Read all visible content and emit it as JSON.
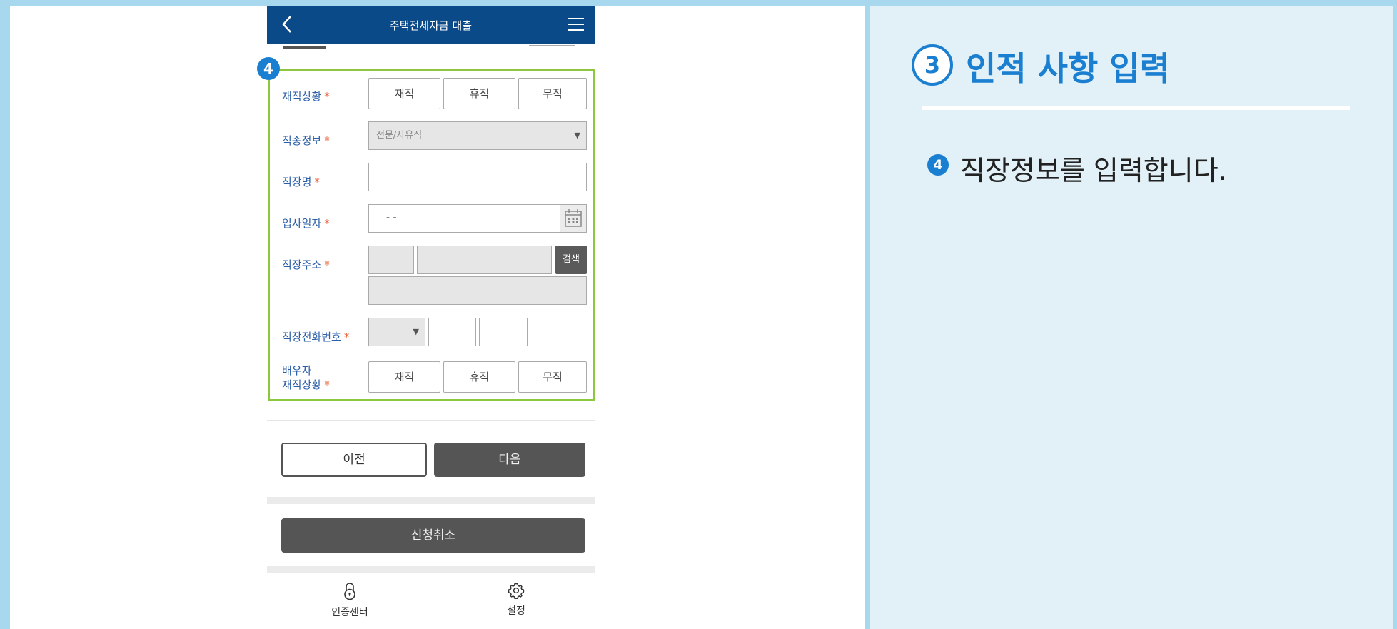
{
  "app": {
    "title": "주택전세자금 대출"
  },
  "marker": "4",
  "form": {
    "employment_status": {
      "label": "재직상황",
      "required": "*",
      "options": [
        "재직",
        "휴직",
        "무직"
      ]
    },
    "job_type": {
      "label": "직종정보",
      "required": "*",
      "selected": "전문/자유직"
    },
    "company_name": {
      "label": "직장명",
      "required": "*",
      "value": ""
    },
    "hire_date": {
      "label": "입사일자",
      "required": "*",
      "value": "- -"
    },
    "company_address": {
      "label": "직장주소",
      "required": "*",
      "search_label": "검색"
    },
    "company_phone": {
      "label": "직장전화번호",
      "required": "*",
      "area_code": ""
    },
    "spouse_status": {
      "label_line1": "배우자",
      "label_line2": "재직상황",
      "required": "*",
      "options": [
        "재직",
        "휴직",
        "무직"
      ]
    }
  },
  "buttons": {
    "prev": "이전",
    "next": "다음",
    "cancel": "신청취소"
  },
  "tabbar": {
    "items": [
      {
        "label": "인증센터",
        "icon": "lock-icon"
      },
      {
        "label": "설정",
        "icon": "gear-icon"
      }
    ]
  },
  "guide": {
    "step_number": "3",
    "title": "인적 사항 입력",
    "item_number": "4",
    "description": "직장정보를 입력합니다."
  },
  "colors": {
    "appbar": "#0b4a88",
    "accent": "#1a7fd1",
    "highlight_border": "#8dc63f",
    "required": "#e8613a",
    "panel_bg": "#e1f1f7",
    "frame": "#a8d8ee"
  }
}
